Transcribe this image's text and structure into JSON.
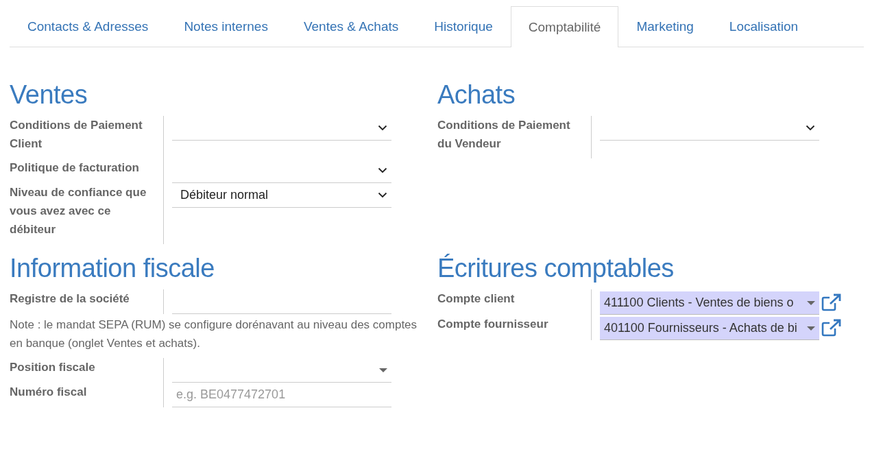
{
  "tabs": [
    {
      "label": "Contacts & Adresses",
      "selected": false
    },
    {
      "label": "Notes internes",
      "selected": false
    },
    {
      "label": "Ventes & Achats",
      "selected": false
    },
    {
      "label": "Historique",
      "selected": false
    },
    {
      "label": "Comptabilité",
      "selected": true
    },
    {
      "label": "Marketing",
      "selected": false
    },
    {
      "label": "Localisation",
      "selected": false
    }
  ],
  "sections": [
    {
      "title": "Ventes",
      "groups": [
        {
          "fields": [
            {
              "label": "Conditions de Paiement Client",
              "kind": "select"
            },
            {
              "label": "Politique de facturation",
              "kind": "select"
            },
            {
              "label": "Niveau de confiance que vous avez avec ce débiteur",
              "kind": "select",
              "value": "Débiteur normal"
            }
          ]
        }
      ]
    },
    {
      "title": "Achats",
      "groups": [
        {
          "fields": [
            {
              "label": "Conditions de Paiement du Vendeur",
              "kind": "select"
            }
          ]
        }
      ]
    },
    {
      "title": "Information fiscale",
      "groups": [
        {
          "fields": [
            {
              "label": "Registre de la société",
              "kind": "input"
            }
          ]
        },
        {
          "note": "Note : le mandat SEPA (RUM) se configure dorénavant au niveau des comptes en banque (onglet Ventes et achats)."
        },
        {
          "fields": [
            {
              "label": "Position fiscale",
              "kind": "dropdown"
            },
            {
              "label": "Numéro fiscal",
              "kind": "input",
              "placeholder": "e.g. BE0477472701"
            }
          ]
        }
      ]
    },
    {
      "title": "Écritures comptables",
      "groups": [
        {
          "fields": [
            {
              "label": "Compte client",
              "kind": "relation",
              "value": "411100 Clients - Ventes de biens o"
            },
            {
              "label": "Compte fournisseur",
              "kind": "relation",
              "value": "401100 Fournisseurs - Achats de bi"
            }
          ]
        }
      ]
    }
  ]
}
